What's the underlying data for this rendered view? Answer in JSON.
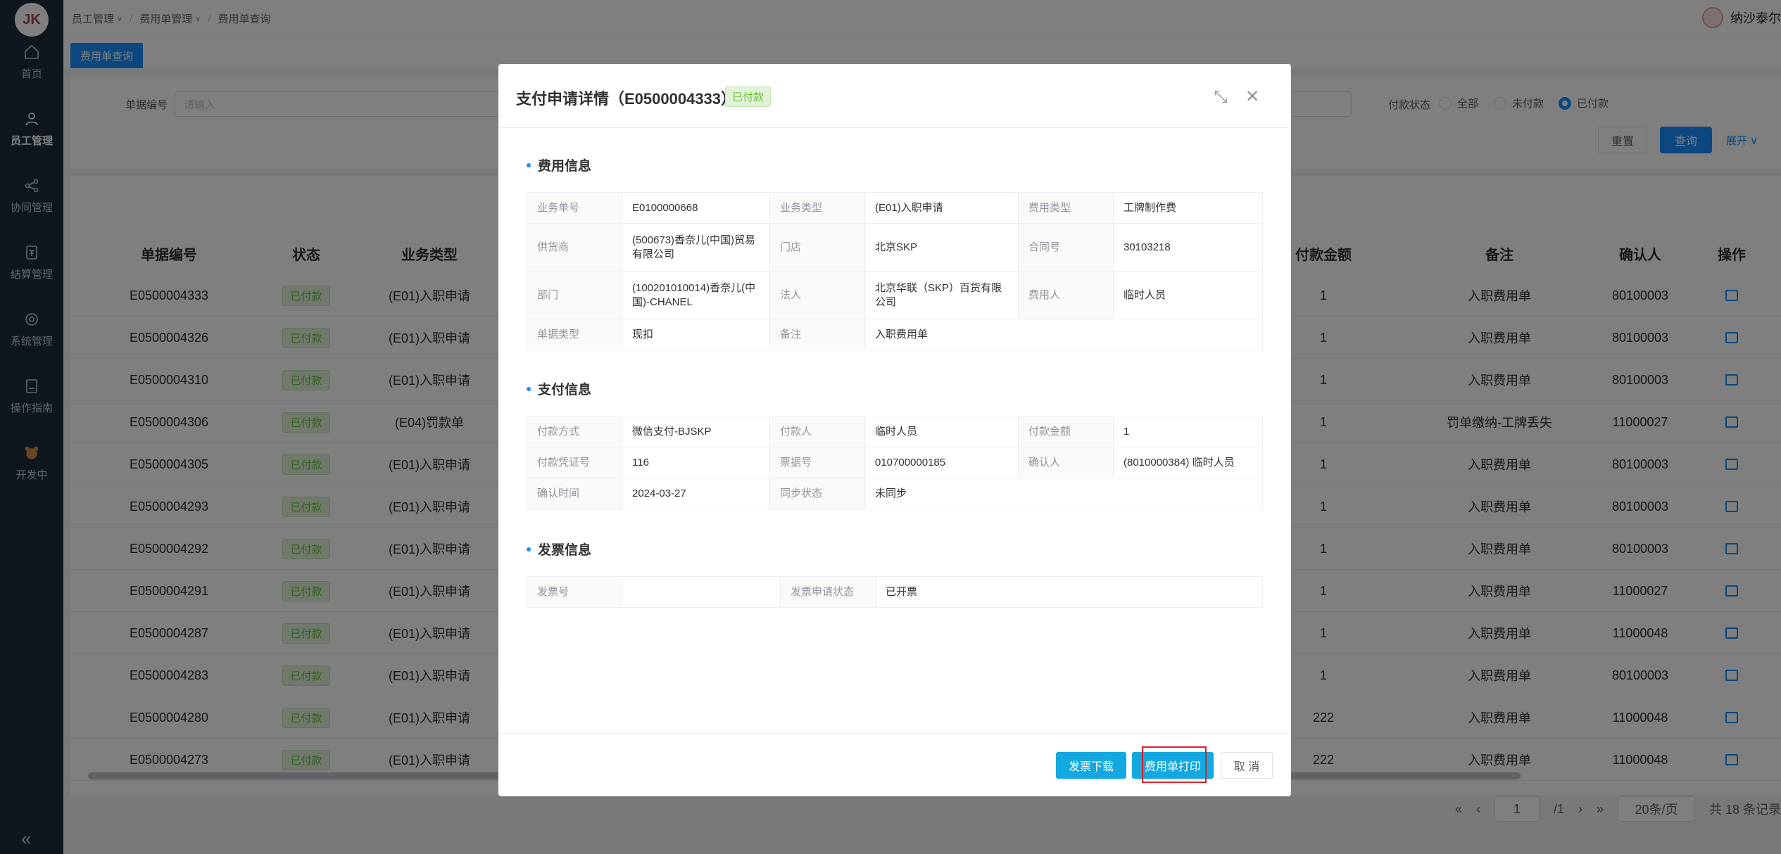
{
  "sidebar": {
    "logo": "JK",
    "items": [
      {
        "label": "首页",
        "icon": "home-icon"
      },
      {
        "label": "员工管理",
        "icon": "user-icon"
      },
      {
        "label": "协同管理",
        "icon": "share-icon"
      },
      {
        "label": "结算管理",
        "icon": "money-icon"
      },
      {
        "label": "系统管理",
        "icon": "gear-icon"
      },
      {
        "label": "操作指南",
        "icon": "book-icon"
      },
      {
        "label": "开发中",
        "icon": "bear-icon"
      }
    ],
    "collapse": "«"
  },
  "breadcrumb": [
    "员工管理",
    "费用单管理",
    "费用单查询"
  ],
  "user": {
    "name": "纳沙泰尔"
  },
  "tabs": [
    {
      "label": "费用单查询"
    }
  ],
  "search": {
    "doc_no_label": "单据编号",
    "doc_no_placeholder": "请输入",
    "pay_status_label": "付款状态",
    "pay_status_options": [
      "全部",
      "未付款",
      "已付款"
    ],
    "reset": "重置",
    "query": "查询",
    "expand": "展开"
  },
  "table": {
    "headers": [
      "单据编号",
      "状态",
      "业务类型",
      "付款金额",
      "备注",
      "确认人",
      "操作"
    ],
    "rows": [
      {
        "no": "E0500004333",
        "status": "已付款",
        "type": "(E01)入职申请",
        "amount": "1",
        "remark": "入职费用单",
        "confirmer": "80100003"
      },
      {
        "no": "E0500004326",
        "status": "已付款",
        "type": "(E01)入职申请",
        "amount": "1",
        "remark": "入职费用单",
        "confirmer": "80100003"
      },
      {
        "no": "E0500004310",
        "status": "已付款",
        "type": "(E01)入职申请",
        "amount": "1",
        "remark": "入职费用单",
        "confirmer": "80100003"
      },
      {
        "no": "E0500004306",
        "status": "已付款",
        "type": "(E04)罚款单",
        "amount": "1",
        "remark": "罚单缴纳-工牌丢失",
        "confirmer": "11000027"
      },
      {
        "no": "E0500004305",
        "status": "已付款",
        "type": "(E01)入职申请",
        "amount": "1",
        "remark": "入职费用单",
        "confirmer": "80100003"
      },
      {
        "no": "E0500004293",
        "status": "已付款",
        "type": "(E01)入职申请",
        "amount": "1",
        "remark": "入职费用单",
        "confirmer": "80100003"
      },
      {
        "no": "E0500004292",
        "status": "已付款",
        "type": "(E01)入职申请",
        "amount": "1",
        "remark": "入职费用单",
        "confirmer": "80100003"
      },
      {
        "no": "E0500004291",
        "status": "已付款",
        "type": "(E01)入职申请",
        "amount": "1",
        "remark": "入职费用单",
        "confirmer": "11000027"
      },
      {
        "no": "E0500004287",
        "status": "已付款",
        "type": "(E01)入职申请",
        "amount": "1",
        "remark": "入职费用单",
        "confirmer": "11000048"
      },
      {
        "no": "E0500004283",
        "status": "已付款",
        "type": "(E01)入职申请",
        "amount": "1",
        "remark": "入职费用单",
        "confirmer": "80100003"
      },
      {
        "no": "E0500004280",
        "status": "已付款",
        "type": "(E01)入职申请",
        "amount": "222",
        "remark": "入职费用单",
        "confirmer": "11000048"
      },
      {
        "no": "E0500004273",
        "status": "已付款",
        "type": "(E01)入职申请",
        "amount": "222",
        "remark": "入职费用单",
        "confirmer": "11000048"
      }
    ]
  },
  "pagination": {
    "page": "1",
    "total_pages": "/1",
    "page_size": "20条/页",
    "total": "共 18 条记录"
  },
  "modal": {
    "title": "支付申请详情（E0500004333）",
    "status_tag": "已付款",
    "sections": {
      "fee": "费用信息",
      "pay": "支付信息",
      "invoice": "发票信息"
    },
    "fee_info": {
      "biz_no_label": "业务单号",
      "biz_no": "E0100000668",
      "biz_type_label": "业务类型",
      "biz_type": "(E01)入职申请",
      "fee_type_label": "费用类型",
      "fee_type": "工牌制作费",
      "supplier_label": "供货商",
      "supplier": "(500673)香奈儿(中国)贸易有限公司",
      "store_label": "门店",
      "store": "北京SKP",
      "contract_label": "合同号",
      "contract": "30103218",
      "dept_label": "部门",
      "dept": "(100201010014)香奈儿(中国)-CHANEL",
      "legal_label": "法人",
      "legal": "北京华联（SKP）百货有限公司",
      "payer_label": "费用人",
      "payer": "临时人员",
      "doc_type_label": "单据类型",
      "doc_type": "现扣",
      "remark_label": "备注",
      "remark": "入职费用单"
    },
    "pay_info": {
      "method_label": "付款方式",
      "method": "微信支付-BJSKP",
      "payer_label": "付款人",
      "payer": "临时人员",
      "amount_label": "付款金额",
      "amount": "1",
      "voucher_label": "付款凭证号",
      "voucher": "116",
      "receipt_label": "票据号",
      "receipt": "010700000185",
      "confirmer_label": "确认人",
      "confirmer": "(8010000384) 临时人员",
      "confirm_time_label": "确认时间",
      "confirm_time": "2024-03-27",
      "sync_label": "同步状态",
      "sync": "未同步"
    },
    "invoice_info": {
      "invoice_no_label": "发票号",
      "invoice_no": "",
      "invoice_status_label": "发票申请状态",
      "invoice_status": "已开票"
    },
    "buttons": {
      "invoice_download": "发票下载",
      "print": "费用单打印",
      "cancel": "取 消"
    }
  }
}
